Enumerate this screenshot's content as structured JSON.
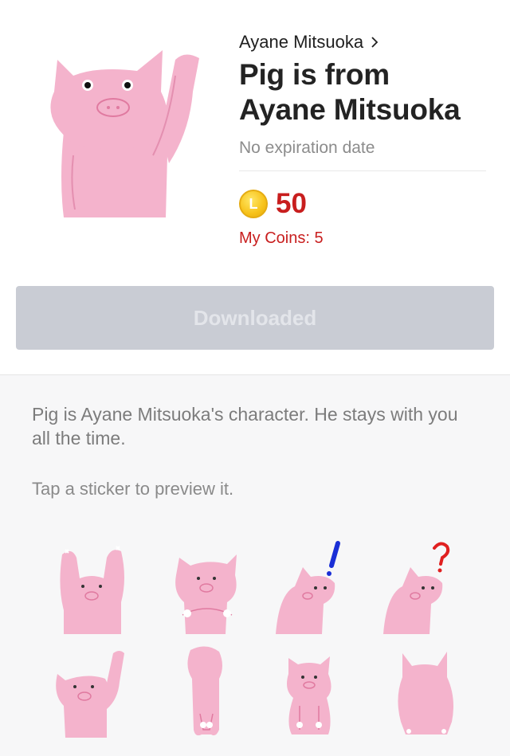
{
  "header": {
    "author": "Ayane Mitsuoka",
    "title_line1": "Pig is from",
    "title_line2": "Ayane Mitsuoka",
    "expiry": "No expiration date"
  },
  "price": {
    "coin_letter": "L",
    "amount": "50",
    "my_coins": "My Coins: 5"
  },
  "download_button": {
    "label": "Downloaded"
  },
  "description": "Pig is Ayane Mitsuoka's character. He stays with you all the time.",
  "preview_hint": "Tap a sticker to preview it.",
  "stickers": [
    {
      "pose": "arms-up"
    },
    {
      "pose": "arms-crossed"
    },
    {
      "pose": "side-exclaim"
    },
    {
      "pose": "side-question"
    },
    {
      "pose": "waving"
    },
    {
      "pose": "bowing"
    },
    {
      "pose": "sitting"
    },
    {
      "pose": "back-view"
    }
  ],
  "colors": {
    "pig_pink": "#f4b3cc",
    "price_red": "#c81e1e",
    "button_gray": "#c9ccd4"
  }
}
